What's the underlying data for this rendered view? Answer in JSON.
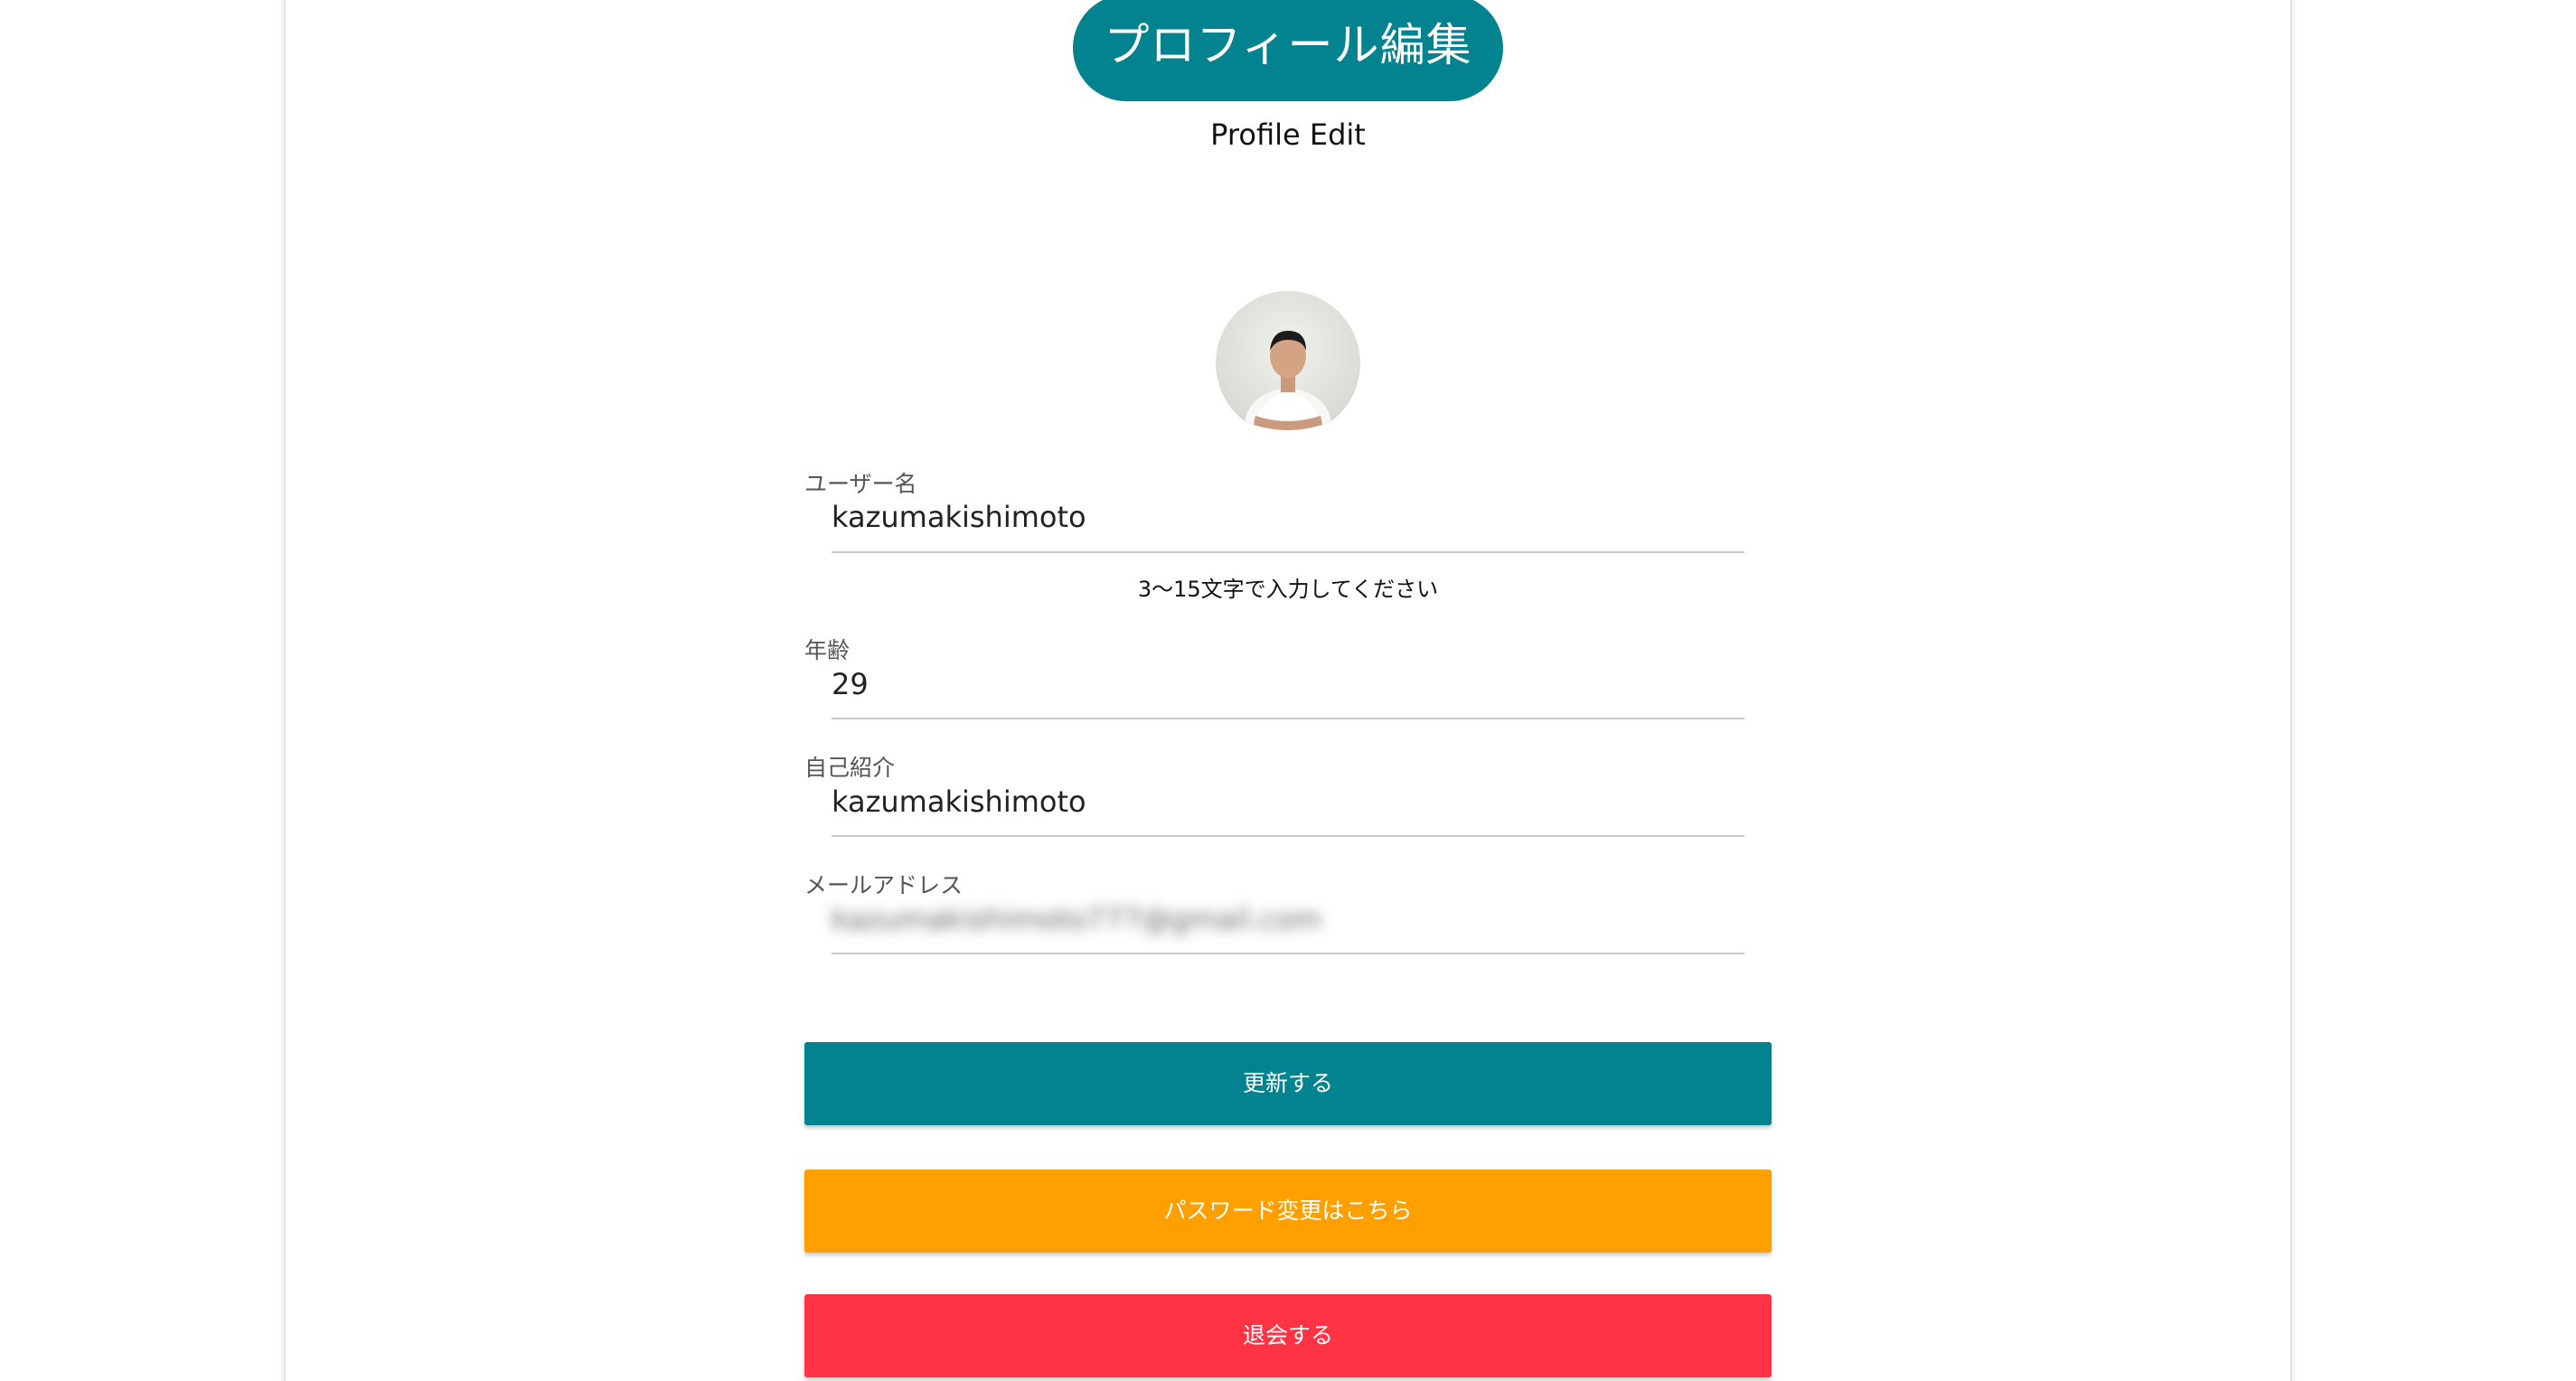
{
  "header": {
    "title": "プロフィール編集",
    "subtitle": "Profile Edit"
  },
  "form": {
    "username": {
      "label": "ユーザー名",
      "value": "kazumakishimoto",
      "hint": "3〜15文字で入力してください"
    },
    "age": {
      "label": "年齢",
      "value": "29"
    },
    "bio": {
      "label": "自己紹介",
      "value": "kazumakishimoto"
    },
    "email": {
      "label": "メールアドレス",
      "value": "kazumakishimoto777@gmail.com"
    }
  },
  "buttons": {
    "update": "更新する",
    "password": "パスワード変更はこちら",
    "withdraw": "退会する"
  },
  "colors": {
    "primary": "#03838f",
    "warning": "#ffa000",
    "danger": "#ff3344"
  },
  "icons": {
    "avatar": "user-photo-avatar"
  }
}
